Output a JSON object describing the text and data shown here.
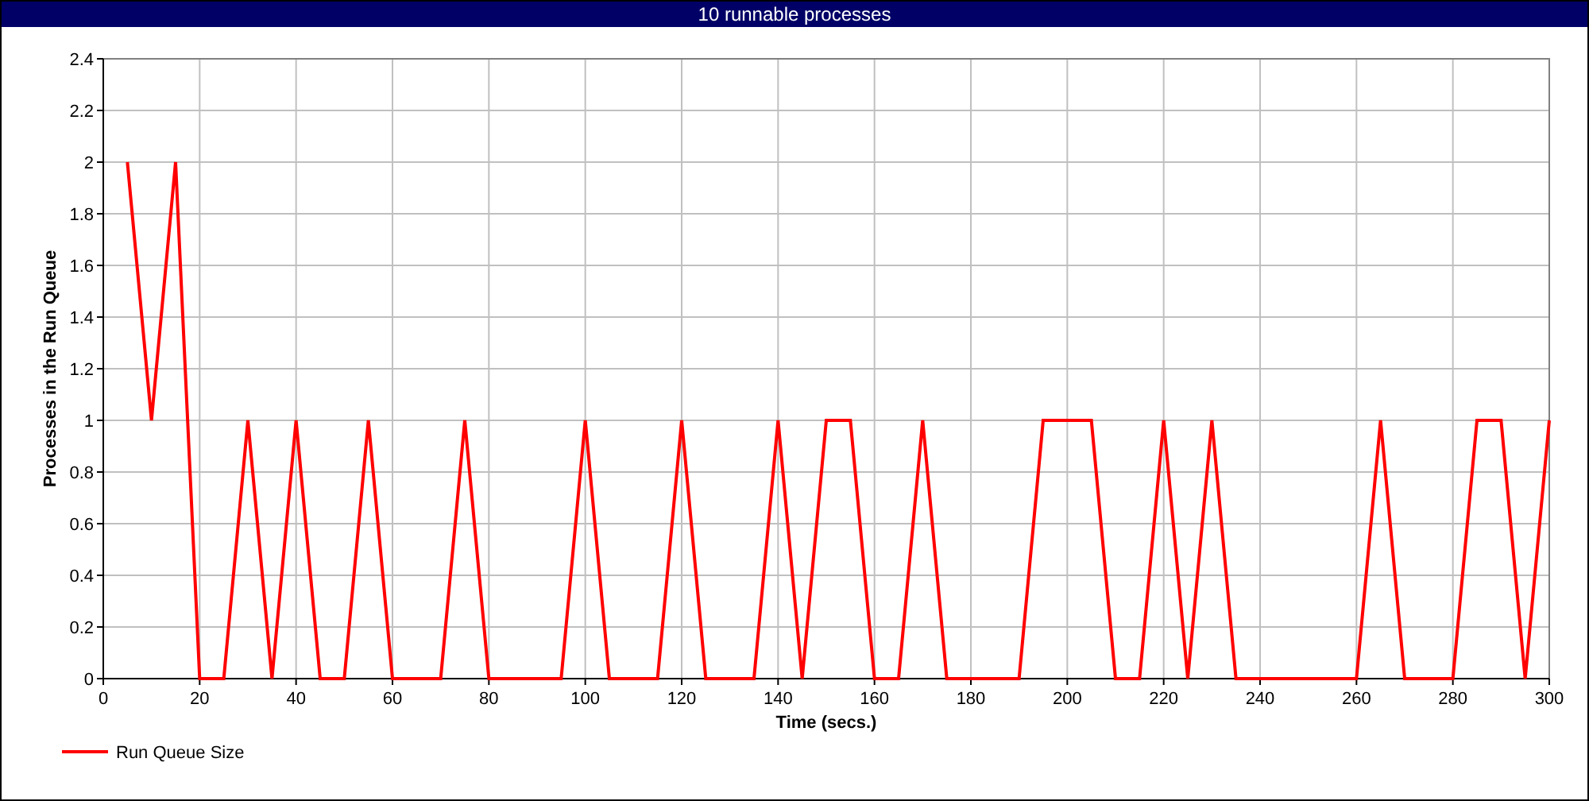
{
  "window": {
    "title": "10 runnable processes"
  },
  "chart": {
    "chart_data": {
      "type": "line",
      "grid": true,
      "xlabel": "Time (secs.)",
      "ylabel": "Processes in the Run Queue",
      "xlim": [
        0,
        300
      ],
      "ylim": [
        0,
        2.4
      ],
      "xticks": [
        0,
        20,
        40,
        60,
        80,
        100,
        120,
        140,
        160,
        180,
        200,
        220,
        240,
        260,
        280,
        300
      ],
      "yticks": [
        0,
        0.2,
        0.4,
        0.6,
        0.8,
        {
          "value": 1,
          "label": "1"
        },
        1.2,
        1.4,
        1.6,
        1.8,
        {
          "value": 2,
          "label": "2"
        },
        2.2,
        2.4
      ],
      "x": [
        5,
        10,
        15,
        20,
        25,
        30,
        35,
        40,
        45,
        50,
        55,
        60,
        65,
        70,
        75,
        80,
        85,
        90,
        95,
        100,
        105,
        110,
        115,
        120,
        125,
        130,
        135,
        140,
        145,
        150,
        155,
        160,
        165,
        170,
        175,
        180,
        185,
        190,
        195,
        200,
        205,
        210,
        215,
        220,
        225,
        230,
        235,
        240,
        245,
        250,
        255,
        260,
        265,
        270,
        275,
        280,
        285,
        290,
        295,
        300
      ],
      "series": [
        {
          "name": "Run Queue Size",
          "color": "#ff0000",
          "values": [
            2,
            1,
            2,
            0,
            0,
            1,
            0,
            1,
            0,
            0,
            1,
            0,
            0,
            0,
            1,
            0,
            0,
            0,
            0,
            1,
            0,
            0,
            0,
            1,
            0,
            0,
            0,
            1,
            0,
            1,
            1,
            0,
            0,
            1,
            0,
            0,
            0,
            0,
            1,
            1,
            1,
            0,
            0,
            1,
            0,
            1,
            0,
            0,
            0,
            0,
            0,
            0,
            1,
            0,
            0,
            0,
            1,
            1,
            0,
            1
          ]
        }
      ]
    }
  }
}
